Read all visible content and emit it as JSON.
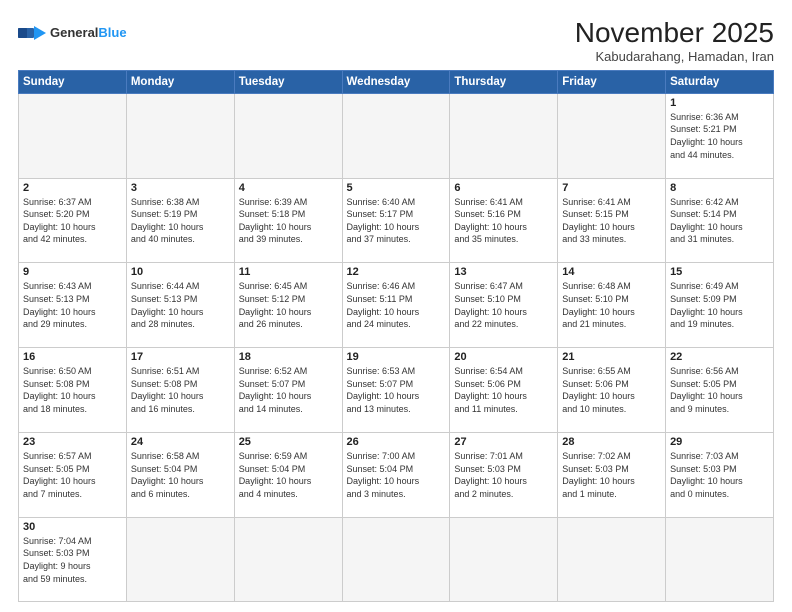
{
  "header": {
    "logo_general": "General",
    "logo_blue": "Blue",
    "title": "November 2025",
    "subtitle": "Kabudarahang, Hamadan, Iran"
  },
  "weekdays": [
    "Sunday",
    "Monday",
    "Tuesday",
    "Wednesday",
    "Thursday",
    "Friday",
    "Saturday"
  ],
  "weeks": [
    [
      {
        "day": "",
        "info": ""
      },
      {
        "day": "",
        "info": ""
      },
      {
        "day": "",
        "info": ""
      },
      {
        "day": "",
        "info": ""
      },
      {
        "day": "",
        "info": ""
      },
      {
        "day": "",
        "info": ""
      },
      {
        "day": "1",
        "info": "Sunrise: 6:36 AM\nSunset: 5:21 PM\nDaylight: 10 hours\nand 44 minutes."
      }
    ],
    [
      {
        "day": "2",
        "info": "Sunrise: 6:37 AM\nSunset: 5:20 PM\nDaylight: 10 hours\nand 42 minutes."
      },
      {
        "day": "3",
        "info": "Sunrise: 6:38 AM\nSunset: 5:19 PM\nDaylight: 10 hours\nand 40 minutes."
      },
      {
        "day": "4",
        "info": "Sunrise: 6:39 AM\nSunset: 5:18 PM\nDaylight: 10 hours\nand 39 minutes."
      },
      {
        "day": "5",
        "info": "Sunrise: 6:40 AM\nSunset: 5:17 PM\nDaylight: 10 hours\nand 37 minutes."
      },
      {
        "day": "6",
        "info": "Sunrise: 6:41 AM\nSunset: 5:16 PM\nDaylight: 10 hours\nand 35 minutes."
      },
      {
        "day": "7",
        "info": "Sunrise: 6:41 AM\nSunset: 5:15 PM\nDaylight: 10 hours\nand 33 minutes."
      },
      {
        "day": "8",
        "info": "Sunrise: 6:42 AM\nSunset: 5:14 PM\nDaylight: 10 hours\nand 31 minutes."
      }
    ],
    [
      {
        "day": "9",
        "info": "Sunrise: 6:43 AM\nSunset: 5:13 PM\nDaylight: 10 hours\nand 29 minutes."
      },
      {
        "day": "10",
        "info": "Sunrise: 6:44 AM\nSunset: 5:13 PM\nDaylight: 10 hours\nand 28 minutes."
      },
      {
        "day": "11",
        "info": "Sunrise: 6:45 AM\nSunset: 5:12 PM\nDaylight: 10 hours\nand 26 minutes."
      },
      {
        "day": "12",
        "info": "Sunrise: 6:46 AM\nSunset: 5:11 PM\nDaylight: 10 hours\nand 24 minutes."
      },
      {
        "day": "13",
        "info": "Sunrise: 6:47 AM\nSunset: 5:10 PM\nDaylight: 10 hours\nand 22 minutes."
      },
      {
        "day": "14",
        "info": "Sunrise: 6:48 AM\nSunset: 5:10 PM\nDaylight: 10 hours\nand 21 minutes."
      },
      {
        "day": "15",
        "info": "Sunrise: 6:49 AM\nSunset: 5:09 PM\nDaylight: 10 hours\nand 19 minutes."
      }
    ],
    [
      {
        "day": "16",
        "info": "Sunrise: 6:50 AM\nSunset: 5:08 PM\nDaylight: 10 hours\nand 18 minutes."
      },
      {
        "day": "17",
        "info": "Sunrise: 6:51 AM\nSunset: 5:08 PM\nDaylight: 10 hours\nand 16 minutes."
      },
      {
        "day": "18",
        "info": "Sunrise: 6:52 AM\nSunset: 5:07 PM\nDaylight: 10 hours\nand 14 minutes."
      },
      {
        "day": "19",
        "info": "Sunrise: 6:53 AM\nSunset: 5:07 PM\nDaylight: 10 hours\nand 13 minutes."
      },
      {
        "day": "20",
        "info": "Sunrise: 6:54 AM\nSunset: 5:06 PM\nDaylight: 10 hours\nand 11 minutes."
      },
      {
        "day": "21",
        "info": "Sunrise: 6:55 AM\nSunset: 5:06 PM\nDaylight: 10 hours\nand 10 minutes."
      },
      {
        "day": "22",
        "info": "Sunrise: 6:56 AM\nSunset: 5:05 PM\nDaylight: 10 hours\nand 9 minutes."
      }
    ],
    [
      {
        "day": "23",
        "info": "Sunrise: 6:57 AM\nSunset: 5:05 PM\nDaylight: 10 hours\nand 7 minutes."
      },
      {
        "day": "24",
        "info": "Sunrise: 6:58 AM\nSunset: 5:04 PM\nDaylight: 10 hours\nand 6 minutes."
      },
      {
        "day": "25",
        "info": "Sunrise: 6:59 AM\nSunset: 5:04 PM\nDaylight: 10 hours\nand 4 minutes."
      },
      {
        "day": "26",
        "info": "Sunrise: 7:00 AM\nSunset: 5:04 PM\nDaylight: 10 hours\nand 3 minutes."
      },
      {
        "day": "27",
        "info": "Sunrise: 7:01 AM\nSunset: 5:03 PM\nDaylight: 10 hours\nand 2 minutes."
      },
      {
        "day": "28",
        "info": "Sunrise: 7:02 AM\nSunset: 5:03 PM\nDaylight: 10 hours\nand 1 minute."
      },
      {
        "day": "29",
        "info": "Sunrise: 7:03 AM\nSunset: 5:03 PM\nDaylight: 10 hours\nand 0 minutes."
      }
    ],
    [
      {
        "day": "30",
        "info": "Sunrise: 7:04 AM\nSunset: 5:03 PM\nDaylight: 9 hours\nand 59 minutes."
      },
      {
        "day": "",
        "info": ""
      },
      {
        "day": "",
        "info": ""
      },
      {
        "day": "",
        "info": ""
      },
      {
        "day": "",
        "info": ""
      },
      {
        "day": "",
        "info": ""
      },
      {
        "day": "",
        "info": ""
      }
    ]
  ],
  "colors": {
    "header_bg": "#2962a6",
    "border": "#cccccc"
  }
}
